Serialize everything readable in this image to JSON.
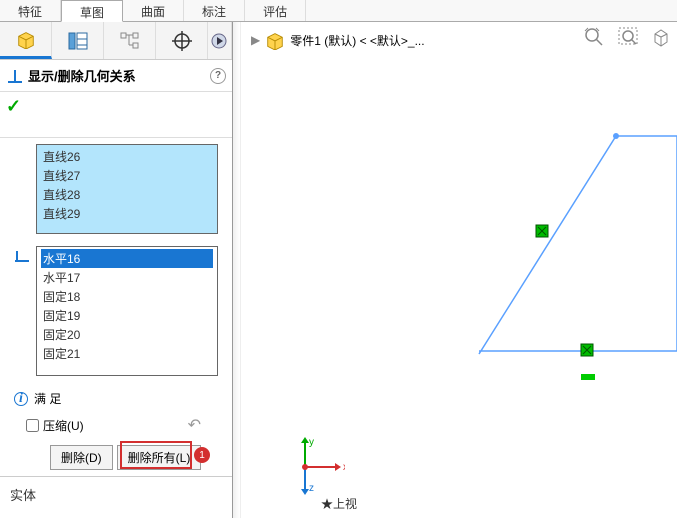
{
  "menubar": {
    "tabs": [
      "特征",
      "草图",
      "曲面",
      "标注",
      "评估"
    ],
    "activeIndex": 1
  },
  "panel": {
    "title": "显示/删除几何关系",
    "entities_label": "实体",
    "lines": [
      "直线26",
      "直线27",
      "直线28",
      "直线29"
    ],
    "relations": [
      "水平16",
      "水平17",
      "固定18",
      "固定19",
      "固定20",
      "固定21"
    ],
    "relations_selectedIndex": 0,
    "status_label": "满 足",
    "suppress_label": "压缩(U)",
    "suppress_checked": false,
    "delete_btn": "删除(D)",
    "delete_all_btn": "删除所有(L)",
    "annotation_number": "1"
  },
  "breadcrumb": {
    "part": "零件1 (默认) < <默认>_..."
  },
  "axes": {
    "x": "x",
    "y": "y",
    "z": "z"
  },
  "bottom_label": "★上视"
}
